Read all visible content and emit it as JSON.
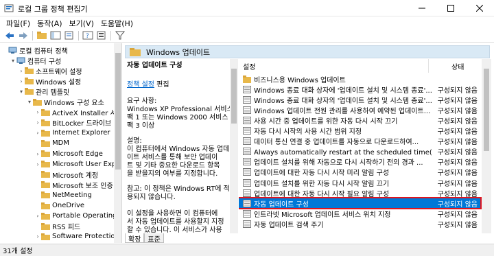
{
  "window": {
    "title": "로컬 그룹 정책 편집기"
  },
  "menubar": {
    "items": [
      "파일(F)",
      "동작(A)",
      "보기(V)",
      "도움말(H)"
    ]
  },
  "toolbar": {
    "icons": [
      "back-icon",
      "forward-icon",
      "up-folder-icon",
      "show-hide-tree-icon",
      "export-icon",
      "help-icon",
      "properties-icon",
      "filter-icon"
    ]
  },
  "tree": {
    "items": [
      {
        "label": "로컬 컴퓨터 정책",
        "level": 0
      },
      {
        "label": "컴퓨터 구성",
        "level": 1
      },
      {
        "label": "소프트웨어 설정",
        "level": 2
      },
      {
        "label": "Windows 설정",
        "level": 2
      },
      {
        "label": "관리 템플릿",
        "level": 2
      },
      {
        "label": "Windows 구성 요소",
        "level": 3
      },
      {
        "label": "ActiveX Installer 서",
        "level": 4
      },
      {
        "label": "BitLocker 드라이브",
        "level": 4
      },
      {
        "label": "Internet Explorer",
        "level": 4
      },
      {
        "label": "MDM",
        "level": 4
      },
      {
        "label": "Microsoft Edge",
        "level": 4
      },
      {
        "label": "Microsoft User Exp",
        "level": 4
      },
      {
        "label": "Microsoft 계정",
        "level": 4
      },
      {
        "label": "Microsoft 보조 인증",
        "level": 4
      },
      {
        "label": "NetMeeting",
        "level": 4
      },
      {
        "label": "OneDrive",
        "level": 4
      },
      {
        "label": "Portable Operating",
        "level": 4
      },
      {
        "label": "RSS 피드",
        "level": 4
      },
      {
        "label": "Software Protectio",
        "level": 4
      }
    ]
  },
  "header": {
    "title": "Windows 업데이트"
  },
  "description": {
    "setting_title": "자동 업데이트 구성",
    "edit_link": "정책 설정",
    "edit_suffix": " 편집",
    "requirements_label": "요구 사항:",
    "requirements_lines": [
      "Windows XP Professional 서비스",
      "팩 1 또는 Windows 2000 서비스",
      "팩 3 이상"
    ],
    "desc_label": "설명:",
    "desc_lines": [
      "이 컴퓨터에서 Windows 자동 업데",
      "이트 서비스를 통해 보안 업데이",
      "트 및 기타 중요한 다운로드 항목",
      "을 받을지의 여부를 지정합니다."
    ],
    "note_lines": [
      "참고: 이 정책은 Windows RT에 적",
      "용되지 않습니다."
    ],
    "extra_lines": [
      "이 설정을 사용하면 이 컴퓨터에",
      "서 자동 업데이트를 사용할지 지정",
      "할 수 있습니다. 이 서비스가 사용"
    ]
  },
  "list": {
    "col_setting": "설정",
    "col_state": "상태",
    "rows": [
      {
        "name": "비즈니스용 Windows 업데이트",
        "state": "",
        "type": "folder"
      },
      {
        "name": "Windows 종료 대화 상자에 '업데이트 설치 및 시스템 종료'...",
        "state": "구성되지 않음",
        "type": "policy"
      },
      {
        "name": "Windows 종료 대화 상자의 '업데이트 설치 및 시스템 종료'...",
        "state": "구성되지 않음",
        "type": "policy"
      },
      {
        "name": "Windows 업데이트 전원 관리를 사용하여 예약된 업데이트...",
        "state": "구성되지 않음",
        "type": "policy"
      },
      {
        "name": "사용 시간 중 업데이트를 위한 자동 다시 시작 끄기",
        "state": "구성되지 않음",
        "type": "policy"
      },
      {
        "name": "자동 다시 시작의 사용 시간 범위 지정",
        "state": "구성되지 않음",
        "type": "policy"
      },
      {
        "name": "데이터 통신 연결 중 업데이트를 자동으로 다운로드하여...",
        "state": "구성되지 않음",
        "type": "policy"
      },
      {
        "name": "Always automatically restart at the scheduled time(항상 예...",
        "state": "구성되지 않음",
        "type": "policy"
      },
      {
        "name": "업데이트 설치를 위해 자동으로 다시 시작하기 전의 경과 ...",
        "state": "구성되지 않음",
        "type": "policy"
      },
      {
        "name": "업데이트에 대한 자동 다시 시작 미리 알림 구성",
        "state": "구성되지 않음",
        "type": "policy"
      },
      {
        "name": "업데이트 설치를 위한 자동 다시 시작 알림 끄기",
        "state": "구성되지 않음",
        "type": "policy"
      },
      {
        "name": "업데이트에 대한 자동 다시 시작 필요 알림 구성",
        "state": "구성되지 않음",
        "type": "policy"
      },
      {
        "name": "자동 업데이트 구성",
        "state": "구성되지 않음",
        "type": "policy",
        "selected": true
      },
      {
        "name": "인트라넷 Microsoft 업데이트 서비스 위치 지정",
        "state": "구성되지 않음",
        "type": "policy"
      },
      {
        "name": "자동 업데이트 검색 주기",
        "state": "구성되지 않음",
        "type": "policy"
      }
    ]
  },
  "tabs": {
    "extended": "확장",
    "standard": "표준"
  },
  "status": {
    "text": "31개 설정"
  },
  "colors": {
    "selection": "#0078d7",
    "highlight_border": "#e0141e",
    "header_bg": "#d9e9f5",
    "folder": "#e8b84a",
    "link": "#0066cc"
  }
}
